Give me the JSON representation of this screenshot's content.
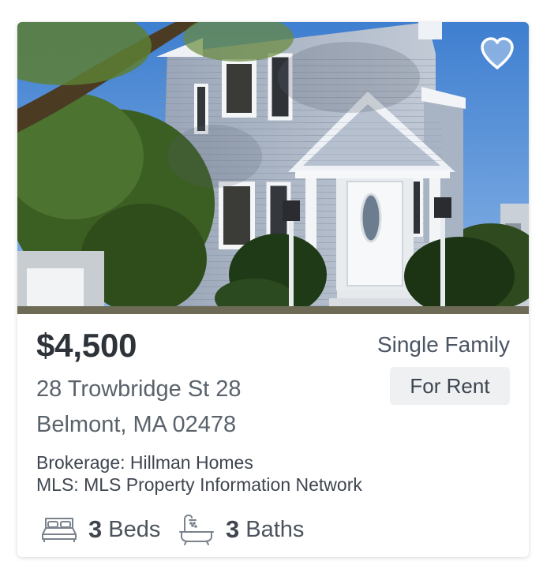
{
  "listing": {
    "price": "$4,500",
    "property_type": "Single Family",
    "status": "For Rent",
    "address_line1": "28 Trowbridge St 28",
    "address_line2": "Belmont, MA 02478",
    "brokerage": "Brokerage: Hillman Homes",
    "mls": "MLS: MLS Property Information Network",
    "beds_count": "3",
    "beds_label": "Beds",
    "baths_count": "3",
    "baths_label": "Baths"
  },
  "icons": {
    "favorite": "heart-icon",
    "beds": "bed-icon",
    "baths": "bathtub-icon"
  },
  "colors": {
    "price_text": "#2d3339",
    "badge_bg": "#eef0f2",
    "secondary_text": "#5a626b"
  }
}
